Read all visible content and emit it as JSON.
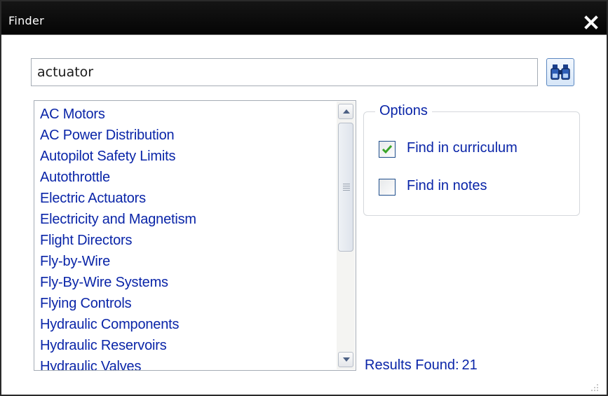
{
  "window": {
    "title": "Finder"
  },
  "search": {
    "value": "actuator",
    "button_icon": "binoculars-icon"
  },
  "results": {
    "items": [
      "AC Motors",
      "AC Power Distribution",
      "Autopilot Safety Limits",
      "Autothrottle",
      "Electric Actuators",
      "Electricity and Magnetism",
      "Flight Directors",
      "Fly-by-Wire",
      "Fly-By-Wire Systems",
      "Flying Controls",
      "Hydraulic Components",
      "Hydraulic Reservoirs",
      "Hydraulic Valves"
    ]
  },
  "options": {
    "legend": "Options",
    "find_in_curriculum": {
      "label": "Find in curriculum",
      "checked": true
    },
    "find_in_notes": {
      "label": "Find in notes",
      "checked": false
    }
  },
  "status": {
    "results_label": "Results Found:",
    "results_count": "21"
  },
  "colors": {
    "titlebar": "#0a0a0a",
    "text_blue": "#0a25a8",
    "check_green": "#3aa529",
    "border": "#a5acb5"
  }
}
